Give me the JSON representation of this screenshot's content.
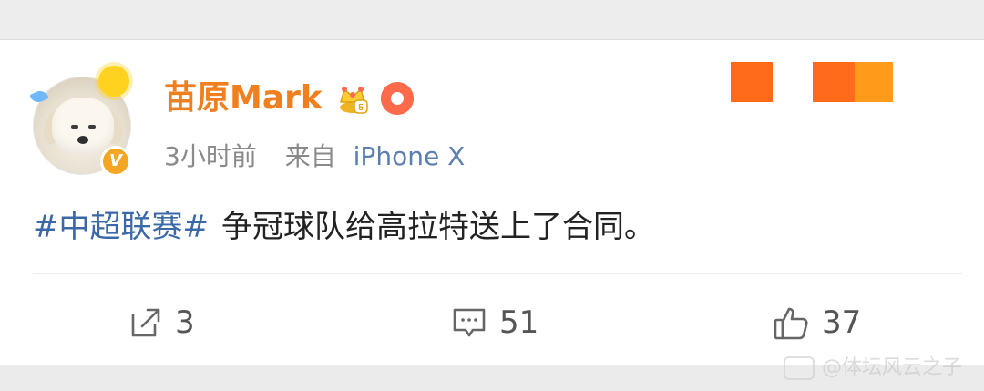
{
  "post": {
    "author_name": "苗原Mark",
    "time": "3小时前",
    "from_label": "来自",
    "device": "iPhone X",
    "topic_tag": "#中超联赛#",
    "text": "争冠球队给高拉特送上了合同。"
  },
  "actions": {
    "share_count": "3",
    "comment_count": "51",
    "like_count": "37"
  },
  "colors": {
    "name": "#f07f1f",
    "tag": "#3b69a8",
    "meta": "#8a8a8a",
    "device": "#5b7fb0",
    "verified": "#f5a623",
    "badge_primary": "#ff6b1a",
    "badge_secondary": "#ff9a1a"
  },
  "icons": {
    "share": "share-arrow-icon",
    "comment": "comment-bubble-icon",
    "like": "thumb-up-icon",
    "crown": "crown-badge-icon",
    "donut": "donut-badge-icon",
    "verified": "verified-v-icon"
  },
  "watermark": "@体坛风云之子"
}
